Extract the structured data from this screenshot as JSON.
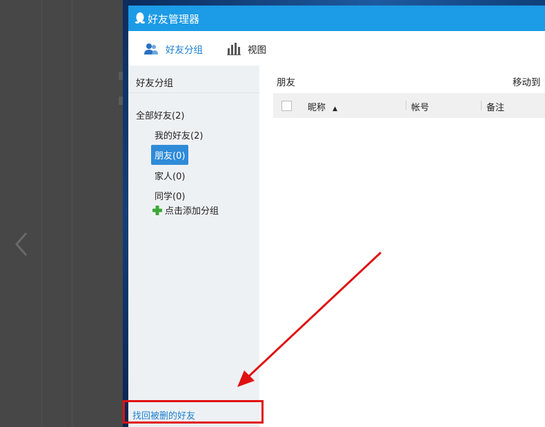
{
  "window": {
    "title": "好友管理器"
  },
  "toolbar": {
    "friend_group_label": "好友分组",
    "view_label": "视图"
  },
  "sidebar": {
    "header": "好友分组",
    "all_friends": "全部好友(2)",
    "groups": [
      {
        "label": "我的好友(2)",
        "selected": false
      },
      {
        "label": "朋友(0)",
        "selected": true
      },
      {
        "label": "家人(0)",
        "selected": false
      },
      {
        "label": "同学(0)",
        "selected": false
      }
    ],
    "add_group_label": "点击添加分组",
    "recover_link": "找回被删的好友"
  },
  "main": {
    "group_title": "朋友",
    "move_to_label": "移动到",
    "columns": [
      "昵称",
      "帐号",
      "备注"
    ],
    "sort_indicator": "▲"
  },
  "icons": {
    "title_logo": "qq-penguin-icon",
    "friend_group": "users-icon",
    "view": "bar-chart-icon",
    "add": "plus-icon",
    "prev": "chevron-left-icon"
  },
  "colors": {
    "titlebar": "#1c9be6",
    "selected_group": "#2f8bd8",
    "link": "#1c7fd0",
    "annotation": "#e01010",
    "add_icon": "#3aa935"
  }
}
